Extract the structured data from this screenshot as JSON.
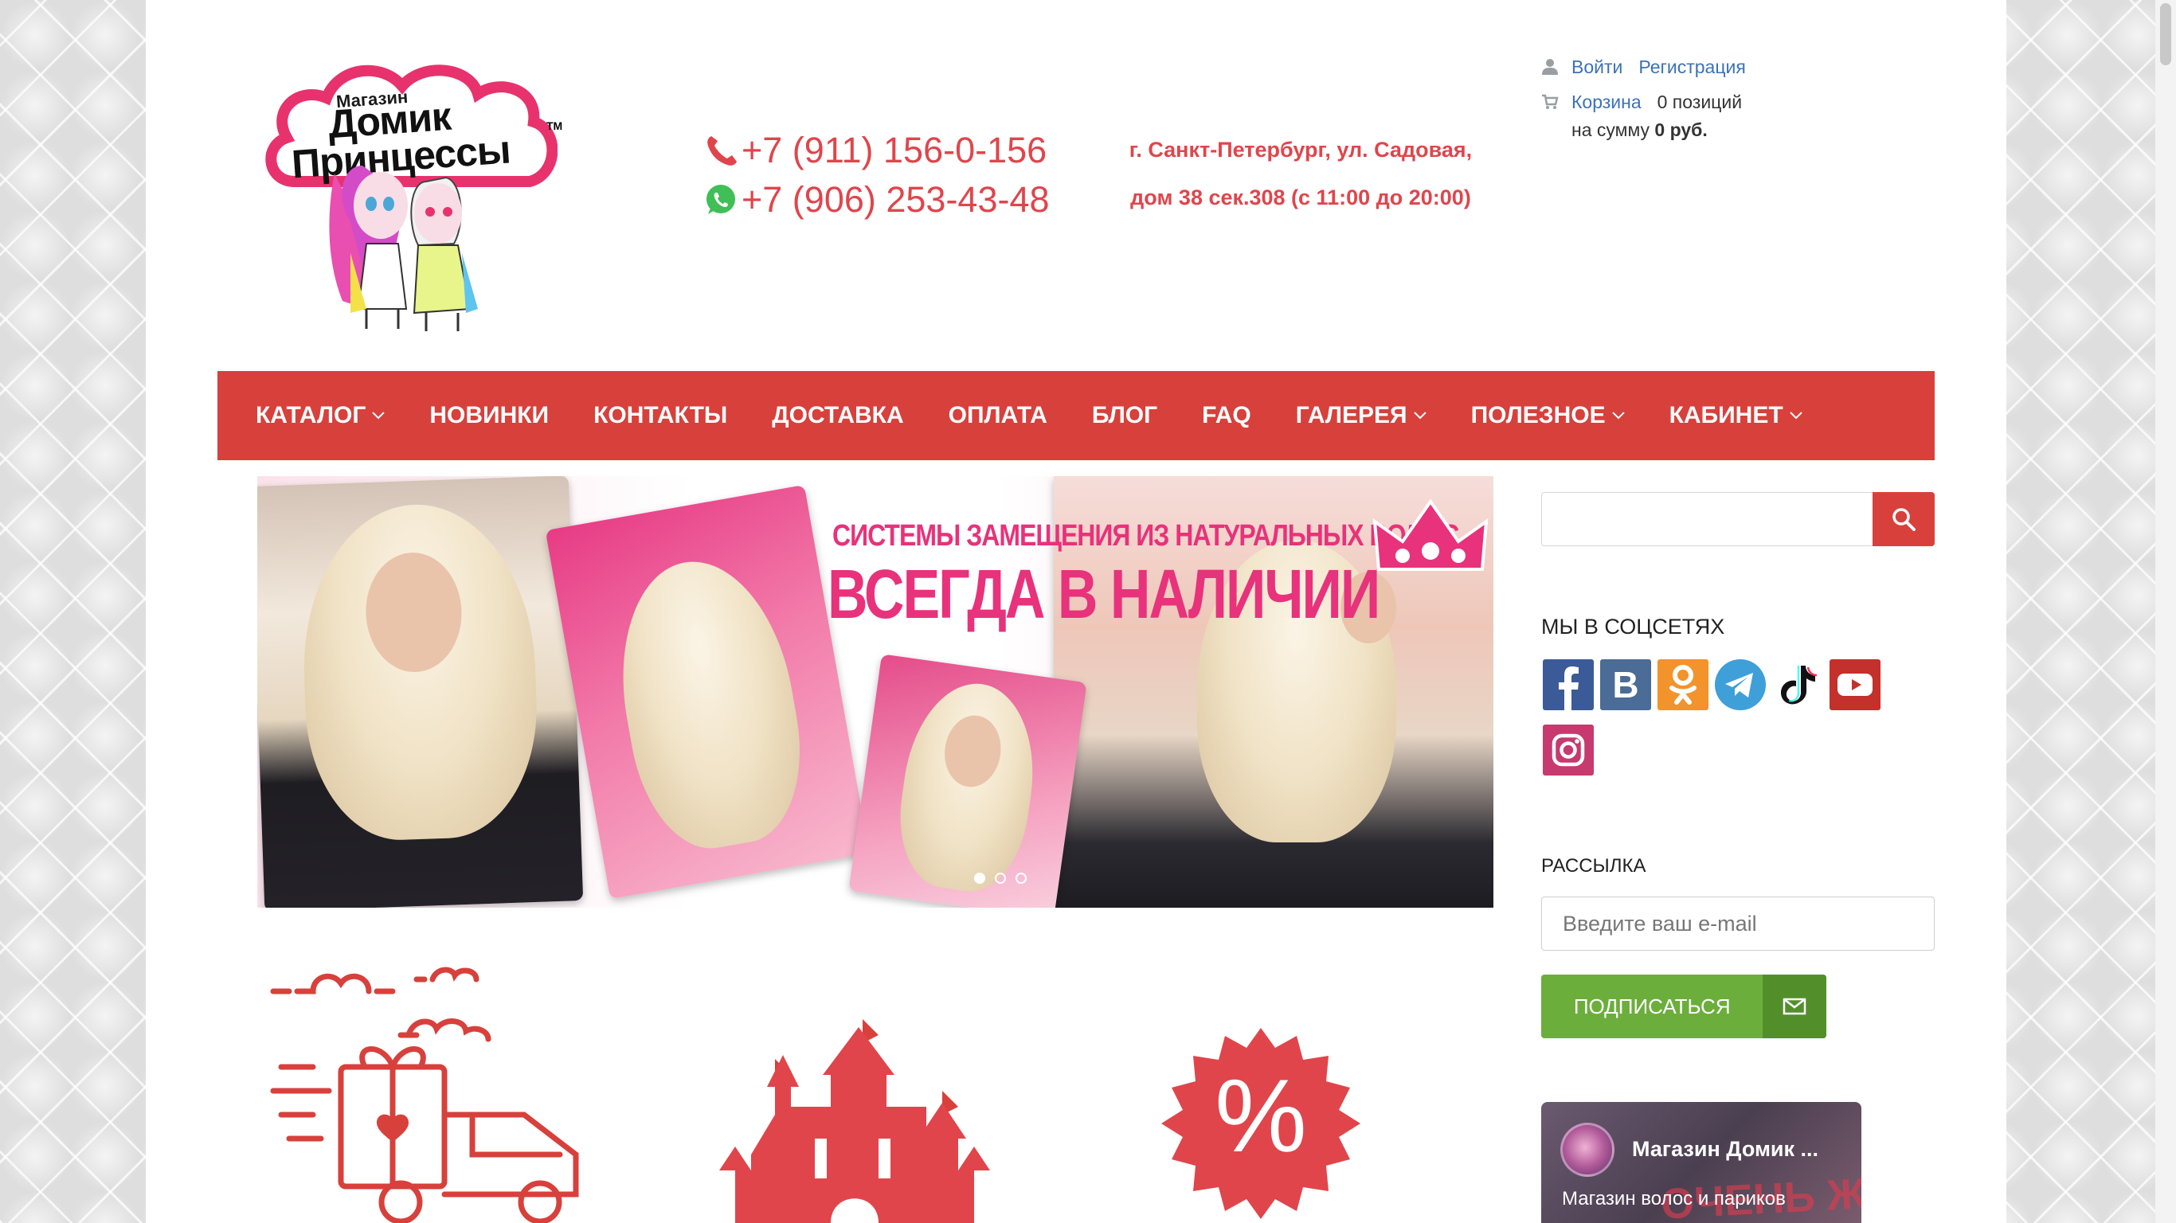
{
  "header": {
    "logo": {
      "line1": "Магазин",
      "line2": "Домик",
      "line3": "Принцессы",
      "tm": "TM"
    },
    "phones": [
      "+7 (911) 156-0-156",
      "+7 (906) 253-43-48"
    ],
    "address_line1": "г. Санкт-Петербург, ул. Садовая,",
    "address_line2": "дом 38 сек.308 (с 11:00 до 20:00)",
    "account": {
      "login": "Войти",
      "register": "Регистрация",
      "cart_link": "Корзина",
      "cart_count": "0 позиций",
      "sum_prefix": "на сумму",
      "sum_value": "0 руб."
    }
  },
  "nav": {
    "items": [
      {
        "label": "КАТАЛОГ",
        "dropdown": true
      },
      {
        "label": "НОВИНКИ",
        "dropdown": false
      },
      {
        "label": "КОНТАКТЫ",
        "dropdown": false
      },
      {
        "label": "ДОСТАВКА",
        "dropdown": false
      },
      {
        "label": "ОПЛАТА",
        "dropdown": false
      },
      {
        "label": "БЛОГ",
        "dropdown": false
      },
      {
        "label": "FAQ",
        "dropdown": false
      },
      {
        "label": "ГАЛЕРЕЯ",
        "dropdown": true
      },
      {
        "label": "ПОЛЕЗНОЕ",
        "dropdown": true
      },
      {
        "label": "КАБИНЕТ",
        "dropdown": true
      }
    ]
  },
  "banner": {
    "headline_small": "СИСТЕМЫ ЗАМЕЩЕНИЯ ИЗ НАТУРАЛЬНЫХ ВОЛОС",
    "headline_big": "ВСЕГДА В НАЛИЧИИ",
    "slides_total": 3,
    "active_slide": 1
  },
  "features": {
    "sale_symbol": "%"
  },
  "sidebar": {
    "search": {
      "placeholder": "",
      "value": ""
    },
    "social_title": "МЫ В СОЦСЕТЯХ",
    "social_icons": [
      "facebook-icon",
      "vk-icon",
      "odnoklassniki-icon",
      "telegram-icon",
      "tiktok-icon",
      "youtube-icon",
      "instagram-icon"
    ],
    "newsletter_title": "РАССЫЛКА",
    "email_placeholder": "Введите ваш e-mail",
    "subscribe_label": "ПОДПИСАТЬСЯ",
    "vk_widget": {
      "name": "Магазин Домик ...",
      "desc": "Магазин волос и париков",
      "promo": "ОЧЕНЬ ЖД"
    }
  },
  "colors": {
    "brand_red": "#d8403c",
    "text_red": "#e0454b",
    "link_blue": "#3b72b8",
    "subscribe_green": "#6cae3c"
  }
}
